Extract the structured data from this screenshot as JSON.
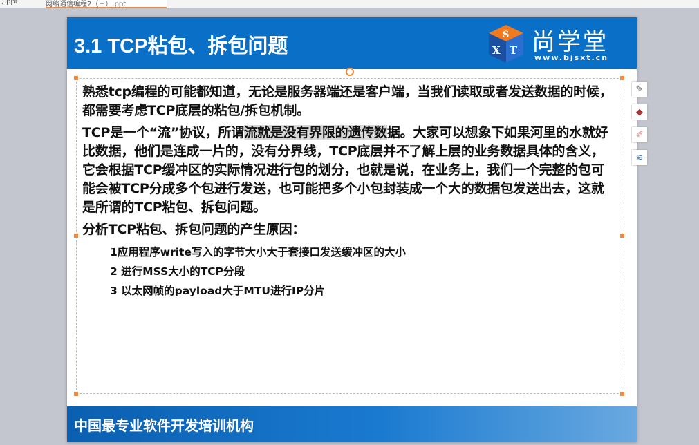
{
  "tabs": [
    {
      "label": ").ppt"
    },
    {
      "label": "网络通信编程2（三）.ppt"
    }
  ],
  "slide": {
    "title": "3.1 TCP粘包、拆包问题",
    "logo": {
      "brand": "尚学堂",
      "url": "www.bjsxt.cn",
      "cube_letters": "SXT"
    },
    "paragraphs": [
      "熟悉tcp编程的可能都知道，无论是服务器端还是客户端，当我们读取或者发送数据的时候，都需要考虑TCP底层的粘包/拆包机制。",
      {
        "before": "TCP是一个“流”协议，所谓",
        "highlight": "流就是没有界限的遗传数",
        "after": "据。大家可以想象下如果河里的水就好比数据，他们是连成一片的，没有分界线，TCP底层并不了解上层的业务数据具体的含义，它会根据TCP缓冲区的实际情况进行包的划分，也就是说，在业务上，我们一个完整的包可能会被TCP分成多个包进行发送，也可能把多个小包封装成一个大的数据包发送出去，这就是所谓的TCP粘包、拆包问题。"
      },
      "分析TCP粘包、拆包问题的产生原因："
    ],
    "list": [
      "1应用程序write写入的字节大小大于套接口发送缓冲区的大小",
      "2 进行MSS大小的TCP分段",
      "3 以太网帧的payload大于MTU进行IP分片"
    ],
    "footer": "中国最专业软件开发培训机构"
  },
  "colors": {
    "header": "#0a6fc6",
    "handle": "#f08a3a"
  },
  "tools": [
    "edit-icon",
    "ink-icon",
    "pen-icon",
    "layers-icon"
  ]
}
